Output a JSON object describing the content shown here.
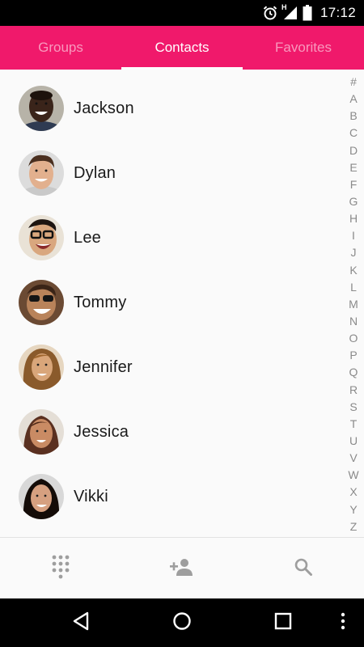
{
  "status_bar": {
    "time": "17:12",
    "network_label": "H",
    "icons": [
      "alarm-icon",
      "signal-icon",
      "battery-icon"
    ]
  },
  "tabs": [
    {
      "label": "Groups",
      "active": false
    },
    {
      "label": "Contacts",
      "active": true
    },
    {
      "label": "Favorites",
      "active": false
    }
  ],
  "contacts": [
    {
      "name": "Jackson"
    },
    {
      "name": "Dylan"
    },
    {
      "name": "Lee"
    },
    {
      "name": "Tommy"
    },
    {
      "name": "Jennifer"
    },
    {
      "name": "Jessica"
    },
    {
      "name": "Vikki"
    }
  ],
  "alphabet": [
    "#",
    "A",
    "B",
    "C",
    "D",
    "E",
    "F",
    "G",
    "H",
    "I",
    "J",
    "K",
    "L",
    "M",
    "N",
    "O",
    "P",
    "Q",
    "R",
    "S",
    "T",
    "U",
    "V",
    "W",
    "X",
    "Y",
    "Z"
  ],
  "toolbar": {
    "icons": [
      "dialpad-icon",
      "add-contact-icon",
      "search-icon"
    ]
  },
  "nav_bar": {
    "icons": [
      "back-icon",
      "home-icon",
      "recents-icon",
      "menu-icon"
    ]
  },
  "colors": {
    "accent": "#f0196b",
    "tab_inactive_text": "#f79abb",
    "icon_gray": "#9e9e9e"
  }
}
